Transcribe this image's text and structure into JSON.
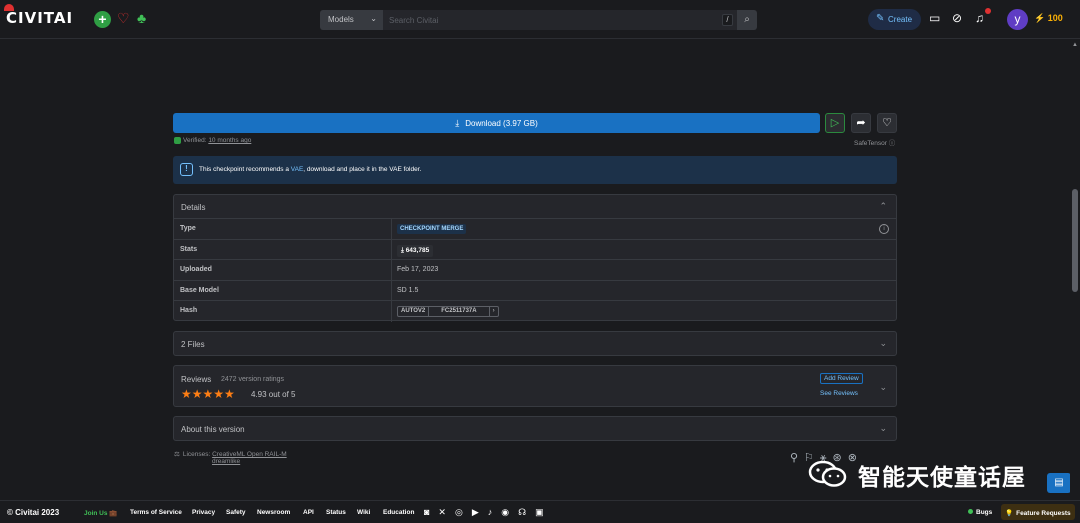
{
  "header": {
    "logo_text": "CIVITAI",
    "search": {
      "scope": "Models",
      "placeholder": "Search Civitai",
      "shortcut": "/"
    },
    "create_label": "Create",
    "avatar_letter": "y",
    "buzz_count": "100"
  },
  "download": {
    "label": "Download (3.97 GB)",
    "verified_prefix": "Verified:",
    "verified_time": "10 months ago",
    "format": "SafeTensor"
  },
  "alert": {
    "prefix": "This checkpoint recommends a ",
    "link": "VAE",
    "suffix": ", download and place it in the VAE folder."
  },
  "details": {
    "title": "Details",
    "rows": [
      {
        "label": "Type",
        "value": "CHECKPOINT MERGE"
      },
      {
        "label": "Stats",
        "value": "643,785"
      },
      {
        "label": "Uploaded",
        "value": "Feb 17, 2023"
      },
      {
        "label": "Base Model",
        "value": "SD 1.5"
      },
      {
        "label": "Hash",
        "hash_type": "AUTOV2",
        "hash_value": "FC2511737A"
      }
    ]
  },
  "files": {
    "title": "2 Files"
  },
  "reviews": {
    "title": "Reviews",
    "count_text": "2472 version ratings",
    "rating": 4.93,
    "score_text": "4.93 out of 5",
    "add_label": "Add Review",
    "see_label": "See Reviews"
  },
  "about": {
    "title": "About this version"
  },
  "license": {
    "prefix": "Licenses:",
    "link1": "CreativeML Open RAIL-M",
    "link2": "dreamlike"
  },
  "watermark": {
    "text": "智能天使童话屋"
  },
  "footer": {
    "copyright": "© Civitai 2023",
    "links": [
      "Join Us 💼",
      "Terms of Service",
      "Privacy",
      "Safety",
      "Newsroom",
      "API",
      "Status",
      "Wiki",
      "Education"
    ],
    "bugs": "Bugs",
    "feature": "Feature Requests"
  },
  "colors": {
    "accent": "#1971c2",
    "background": "#1a1b1e",
    "panel": "#25262b",
    "star": "#fd7e14"
  }
}
